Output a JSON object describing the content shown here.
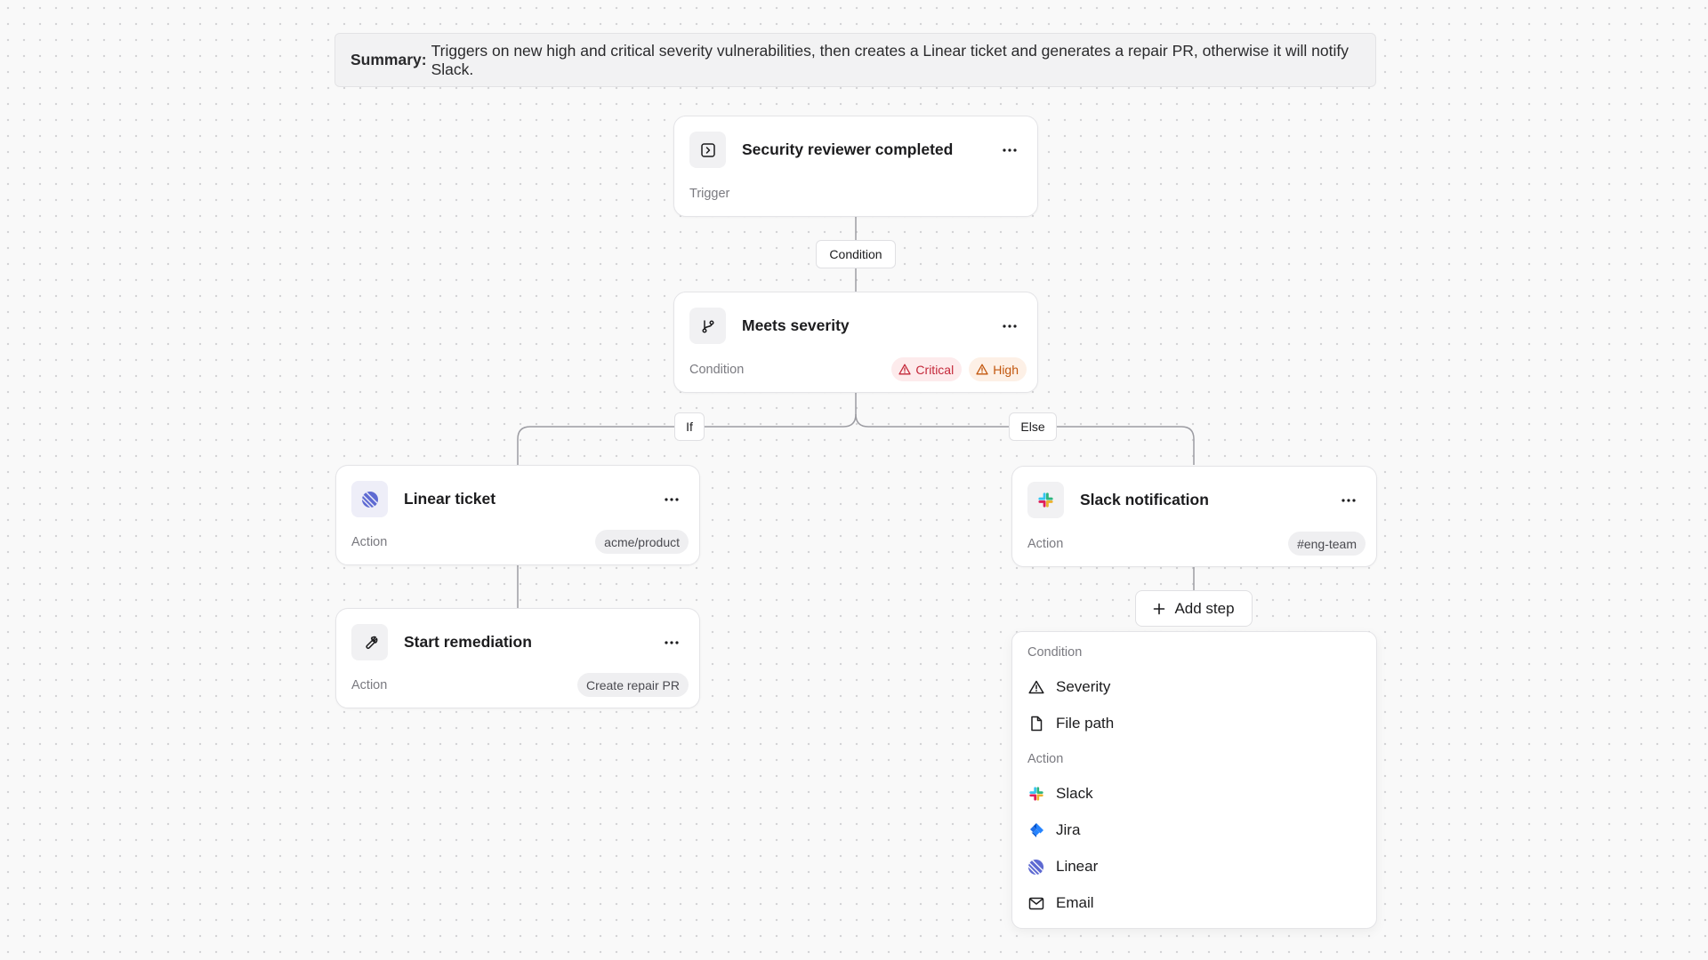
{
  "summary": {
    "label": "Summary:",
    "text": "Triggers on new high and critical severity vulnerabilities, then creates a Linear ticket and generates a repair PR, otherwise it will notify Slack."
  },
  "nodes": {
    "trigger": {
      "title": "Security reviewer completed",
      "type": "Trigger",
      "icon": "terminal-icon"
    },
    "condition": {
      "title": "Meets severity",
      "type": "Condition",
      "icon": "git-branch-icon",
      "badges": [
        {
          "label": "Critical",
          "color": "#c4283a"
        },
        {
          "label": "High",
          "color": "#c2570e"
        }
      ]
    },
    "linear": {
      "title": "Linear ticket",
      "type": "Action",
      "tag": "acme/product",
      "icon": "linear-icon"
    },
    "remediation": {
      "title": "Start remediation",
      "type": "Action",
      "tag": "Create repair PR",
      "icon": "wrench-icon"
    },
    "slack": {
      "title": "Slack notification",
      "type": "Action",
      "tag": "#eng-team",
      "icon": "slack-icon"
    }
  },
  "connectors": {
    "condition": "Condition",
    "if": "If",
    "else": "Else"
  },
  "add_step": {
    "label": "Add step"
  },
  "menu": {
    "sections": [
      {
        "label": "Condition",
        "items": [
          {
            "label": "Severity",
            "icon": "alert-triangle-icon"
          },
          {
            "label": "File path",
            "icon": "file-icon"
          }
        ]
      },
      {
        "label": "Action",
        "items": [
          {
            "label": "Slack",
            "icon": "slack-icon"
          },
          {
            "label": "Jira",
            "icon": "jira-icon"
          },
          {
            "label": "Linear",
            "icon": "linear-icon"
          },
          {
            "label": "Email",
            "icon": "mail-icon"
          }
        ]
      }
    ]
  },
  "colors": {
    "critical": "#c4283a",
    "high": "#c2570e",
    "linear": "#5e6ad2",
    "jira": "#2684ff"
  }
}
